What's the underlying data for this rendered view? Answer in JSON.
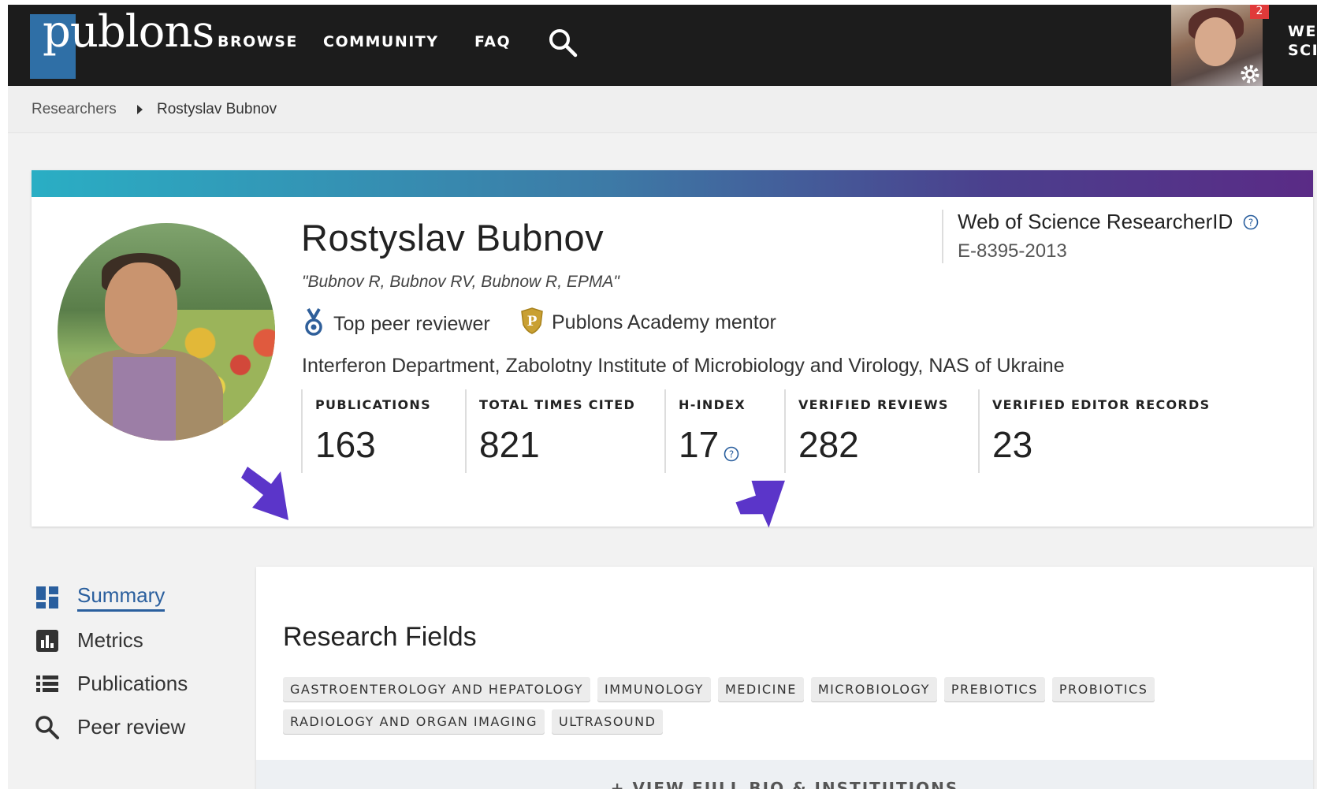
{
  "nav": {
    "logo_text": "publons",
    "items": [
      "BROWSE",
      "COMMUNITY",
      "FAQ"
    ],
    "notification_count": "2",
    "wos_label_line1": "WEB",
    "wos_label_line2": "SCIE"
  },
  "breadcrumb": {
    "parent": "Researchers",
    "current": "Rostyslav Bubnov"
  },
  "profile": {
    "name": "Rostyslav Bubnov",
    "aliases": "\"Bubnov R, Bubnov RV, Bubnow R, EPMA\"",
    "awards": [
      {
        "label": "Top peer reviewer",
        "icon": "medal-icon"
      },
      {
        "label": "Publons Academy mentor",
        "icon": "shield-p-icon"
      }
    ],
    "affiliation": "Interferon Department, Zabolotny Institute of Microbiology and Virology, NAS of Ukraine",
    "researcher_id_title": "Web of Science ResearcherID",
    "researcher_id": "E-8395-2013",
    "metrics": [
      {
        "label": "PUBLICATIONS",
        "value": "163"
      },
      {
        "label": "TOTAL TIMES CITED",
        "value": "821"
      },
      {
        "label": "H-INDEX",
        "value": "17"
      },
      {
        "label": "VERIFIED REVIEWS",
        "value": "282"
      },
      {
        "label": "VERIFIED EDITOR RECORDS",
        "value": "23"
      }
    ]
  },
  "sidebar": {
    "items": [
      {
        "label": "Summary",
        "icon": "dashboard-icon",
        "active": true
      },
      {
        "label": "Metrics",
        "icon": "bar-chart-icon",
        "active": false
      },
      {
        "label": "Publications",
        "icon": "list-icon",
        "active": false
      },
      {
        "label": "Peer review",
        "icon": "search-icon",
        "active": false
      }
    ]
  },
  "research_fields": {
    "title": "Research Fields",
    "tags": [
      "GASTROENTEROLOGY AND HEPATOLOGY",
      "IMMUNOLOGY",
      "MEDICINE",
      "MICROBIOLOGY",
      "PREBIOTICS",
      "PROBIOTICS",
      "RADIOLOGY AND ORGAN IMAGING",
      "ULTRASOUND"
    ],
    "view_full": "+ VIEW FULL BIO & INSTITUTIONS"
  },
  "colors": {
    "nav_bg": "#1c1c1c",
    "accent_link": "#2a5f9e",
    "gradient_start": "#2aaec4",
    "gradient_end": "#5a2b86",
    "annotation_arrow": "#5b35c9"
  }
}
